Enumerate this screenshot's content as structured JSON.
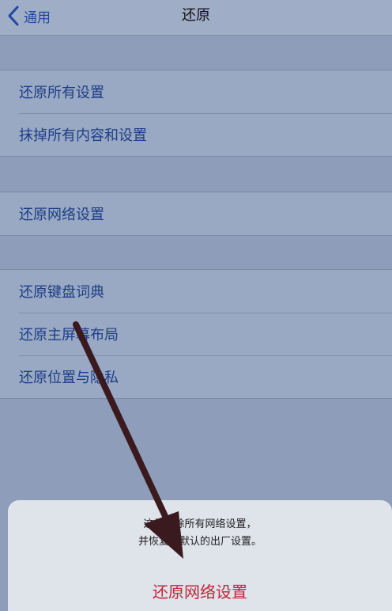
{
  "navbar": {
    "back_label": "通用",
    "title": "还原"
  },
  "groups": [
    {
      "items": [
        "还原所有设置",
        "抹掉所有内容和设置"
      ]
    },
    {
      "items": [
        "还原网络设置"
      ]
    },
    {
      "items": [
        "还原键盘词典",
        "还原主屏幕布局",
        "还原位置与隐私"
      ]
    }
  ],
  "action_sheet": {
    "message_line1": "这将删除所有网络设置，",
    "message_line2": "并恢复到默认的出厂设置。",
    "action_label": "还原网络设置"
  },
  "colors": {
    "background": "#8e9db9",
    "link_blue": "#1f4aa0",
    "destructive_red": "#c2263a",
    "arrow": "#3a1a1f"
  },
  "icons": {
    "back": "chevron-left-icon",
    "annotation": "arrow-annotation"
  }
}
